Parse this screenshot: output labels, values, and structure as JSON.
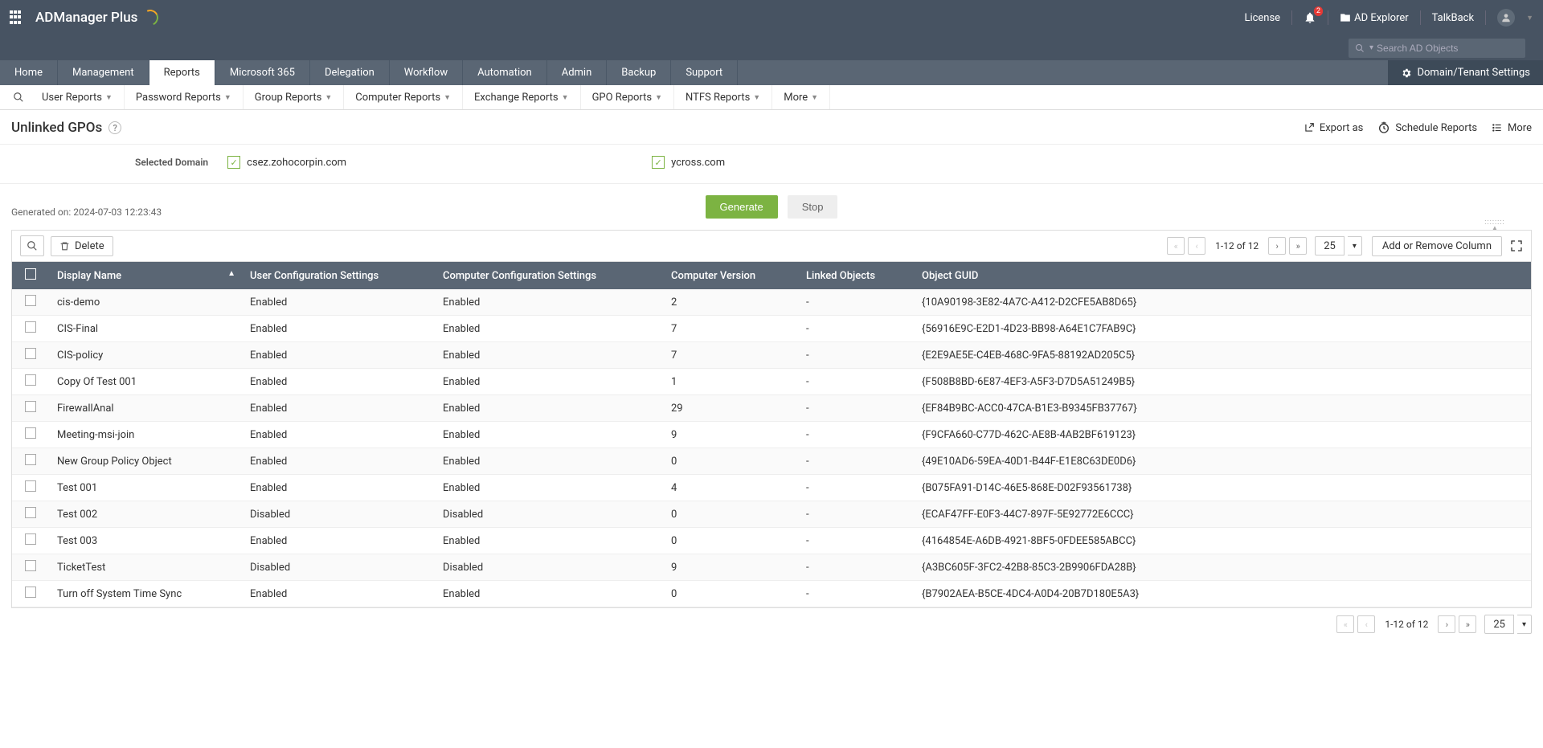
{
  "topbar": {
    "product": "ADManager Plus",
    "license": "License",
    "notifications": "2",
    "adExplorer": "AD Explorer",
    "talkback": "TalkBack",
    "search_placeholder": "Search AD Objects"
  },
  "mainnav": [
    "Home",
    "Management",
    "Reports",
    "Microsoft 365",
    "Delegation",
    "Workflow",
    "Automation",
    "Admin",
    "Backup",
    "Support"
  ],
  "mainnav_active": "Reports",
  "domain_settings": "Domain/Tenant Settings",
  "subnav": [
    "User Reports",
    "Password Reports",
    "Group Reports",
    "Computer Reports",
    "Exchange Reports",
    "GPO Reports",
    "NTFS Reports",
    "More"
  ],
  "page": {
    "title": "Unlinked GPOs",
    "export_as": "Export as",
    "schedule": "Schedule Reports",
    "more": "More"
  },
  "domains": {
    "label": "Selected Domain",
    "list": [
      {
        "name": "csez.zohocorpin.com",
        "checked": true
      },
      {
        "name": "ycross.com",
        "checked": true
      }
    ]
  },
  "actions": {
    "generate": "Generate",
    "stop": "Stop",
    "delete": "Delete",
    "add_remove_column": "Add or Remove Column"
  },
  "generated_on": "Generated on: 2024-07-03 12:23:43",
  "pager": {
    "text": "1-12 of 12",
    "size": "25"
  },
  "columns": [
    "Display Name",
    "User Configuration Settings",
    "Computer Configuration Settings",
    "Computer Version",
    "Linked Objects",
    "Object GUID"
  ],
  "rows": [
    {
      "name": "cis-demo",
      "user": "Enabled",
      "comp": "Enabled",
      "ver": "2",
      "linked": "-",
      "guid": "{10A90198-3E82-4A7C-A412-D2CFE5AB8D65}"
    },
    {
      "name": "CIS-Final",
      "user": "Enabled",
      "comp": "Enabled",
      "ver": "7",
      "linked": "-",
      "guid": "{56916E9C-E2D1-4D23-BB98-A64E1C7FAB9C}"
    },
    {
      "name": "CIS-policy",
      "user": "Enabled",
      "comp": "Enabled",
      "ver": "7",
      "linked": "-",
      "guid": "{E2E9AE5E-C4EB-468C-9FA5-88192AD205C5}"
    },
    {
      "name": "Copy Of Test 001",
      "user": "Enabled",
      "comp": "Enabled",
      "ver": "1",
      "linked": "-",
      "guid": "{F508B8BD-6E87-4EF3-A5F3-D7D5A51249B5}"
    },
    {
      "name": "FirewallAnal",
      "user": "Enabled",
      "comp": "Enabled",
      "ver": "29",
      "linked": "-",
      "guid": "{EF84B9BC-ACC0-47CA-B1E3-B9345FB37767}"
    },
    {
      "name": "Meeting-msi-join",
      "user": "Enabled",
      "comp": "Enabled",
      "ver": "9",
      "linked": "-",
      "guid": "{F9CFA660-C77D-462C-AE8B-4AB2BF619123}"
    },
    {
      "name": "New Group Policy Object",
      "user": "Enabled",
      "comp": "Enabled",
      "ver": "0",
      "linked": "-",
      "guid": "{49E10AD6-59EA-40D1-B44F-E1E8C63DE0D6}"
    },
    {
      "name": "Test 001",
      "user": "Enabled",
      "comp": "Enabled",
      "ver": "4",
      "linked": "-",
      "guid": "{B075FA91-D14C-46E5-868E-D02F93561738}"
    },
    {
      "name": "Test 002",
      "user": "Disabled",
      "comp": "Disabled",
      "ver": "0",
      "linked": "-",
      "guid": "{ECAF47FF-E0F3-44C7-897F-5E92772E6CCC}"
    },
    {
      "name": "Test 003",
      "user": "Enabled",
      "comp": "Enabled",
      "ver": "0",
      "linked": "-",
      "guid": "{4164854E-A6DB-4921-8BF5-0FDEE585ABCC}"
    },
    {
      "name": "TicketTest",
      "user": "Disabled",
      "comp": "Disabled",
      "ver": "9",
      "linked": "-",
      "guid": "{A3BC605F-3FC2-42B8-85C3-2B9906FDA28B}"
    },
    {
      "name": "Turn off System Time Sync",
      "user": "Enabled",
      "comp": "Enabled",
      "ver": "0",
      "linked": "-",
      "guid": "{B7902AEA-B5CE-4DC4-A0D4-20B7D180E5A3}"
    }
  ]
}
